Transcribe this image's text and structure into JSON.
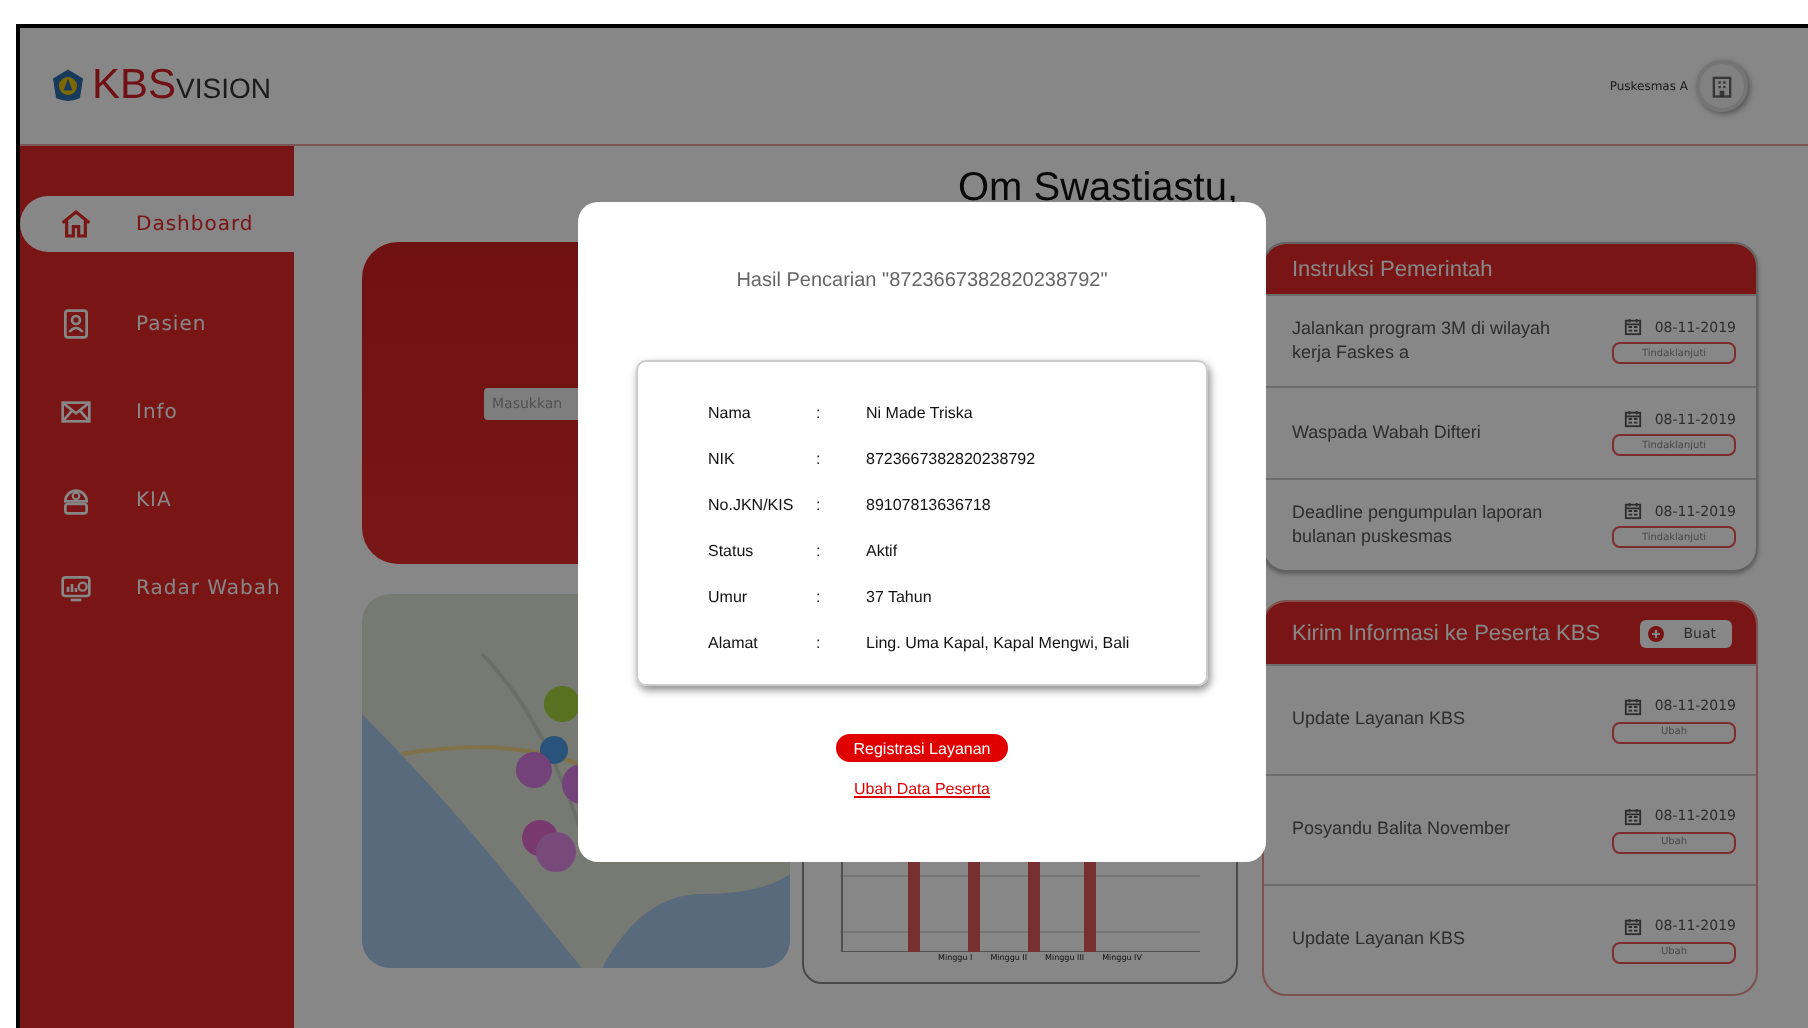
{
  "header": {
    "logo": {
      "brand": "KBS",
      "suffix": "VISION"
    },
    "user": "Puskesmas A"
  },
  "sidebar": {
    "items": [
      {
        "label": "Dashboard",
        "kind": "home",
        "selected": true
      },
      {
        "label": "Pasien",
        "kind": "card",
        "selected": false
      },
      {
        "label": "Info",
        "kind": "mail",
        "selected": false
      },
      {
        "label": "KIA",
        "kind": "baby",
        "selected": false
      },
      {
        "label": "Radar Wabah",
        "kind": "monitor",
        "selected": false
      }
    ]
  },
  "greeting": "Om Swastiastu,",
  "search_card": {
    "placeholder": "Masukkan"
  },
  "weekly_chart": {
    "labels": [
      "Minggu I",
      "Minggu II",
      "Minggu III",
      "Minggu IV"
    ]
  },
  "instructions": {
    "title": "Instruksi Pemerintah",
    "items": [
      {
        "text": "Jalankan program 3M di wilayah kerja Faskes a",
        "date": "08-11-2019",
        "action": "Tindaklanjuti"
      },
      {
        "text": "Waspada Wabah Difteri",
        "date": "08-11-2019",
        "action": "Tindaklanjuti"
      },
      {
        "text": "Deadline pengumpulan laporan bulanan puskesmas",
        "date": "08-11-2019",
        "action": "Tindaklanjuti"
      }
    ]
  },
  "broadcast": {
    "title": "Kirim Informasi ke Peserta KBS",
    "button": "Buat",
    "items": [
      {
        "text": "Update Layanan KBS",
        "date": "08-11-2019",
        "action": "Ubah"
      },
      {
        "text": "Posyandu Balita November",
        "date": "08-11-2019",
        "action": "Ubah"
      },
      {
        "text": "Update Layanan KBS",
        "date": "08-11-2019",
        "action": "Ubah"
      }
    ]
  },
  "modal": {
    "title": "Hasil Pencarian \"8723667382820238792\"",
    "fields": [
      {
        "label": "Nama",
        "colon": ":",
        "value": "Ni Made Triska"
      },
      {
        "label": "NIK",
        "colon": ":",
        "value": "8723667382820238792"
      },
      {
        "label": "No.JKN/KIS",
        "colon": ":",
        "value": "89107813636718"
      },
      {
        "label": "Status",
        "colon": ":",
        "value": "Aktif"
      },
      {
        "label": "Umur",
        "colon": ":",
        "value": "37 Tahun"
      },
      {
        "label": "Alamat",
        "colon": ":",
        "value": "Ling. Uma Kapal, Kapal Mengwi, Bali"
      }
    ],
    "primary_button": "Registrasi Layanan",
    "link": "Ubah Data Peserta"
  }
}
